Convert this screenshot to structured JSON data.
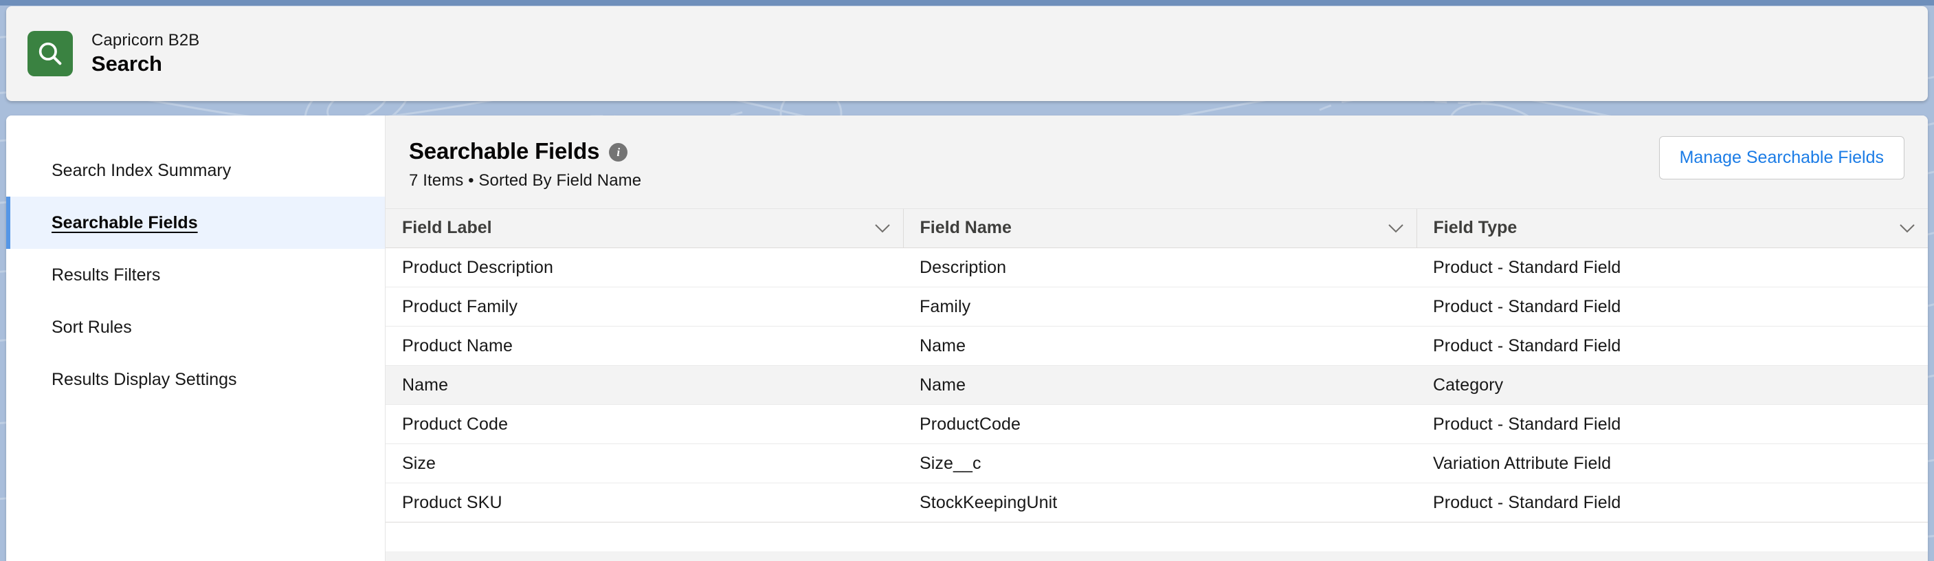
{
  "app": {
    "icon": "search-icon",
    "eyebrow": "Capricorn B2B",
    "title": "Search",
    "icon_color": "#3a8241"
  },
  "sidebar": {
    "items": [
      {
        "label": "Search Index Summary",
        "active": false
      },
      {
        "label": "Searchable Fields",
        "active": true
      },
      {
        "label": "Results Filters",
        "active": false
      },
      {
        "label": "Sort Rules",
        "active": false
      },
      {
        "label": "Results Display Settings",
        "active": false
      }
    ],
    "active_accent": "#5596e6",
    "active_background": "#ecf3fe"
  },
  "main": {
    "title": "Searchable Fields",
    "info_icon": "info-circle-icon",
    "subtitle": "7 Items • Sorted By Field Name",
    "item_count": 7,
    "sorted_by": "Field Name",
    "manage_button": "Manage Searchable Fields",
    "manage_button_color": "#1b7ce6"
  },
  "table": {
    "columns": [
      {
        "label": "Field Label",
        "sort_icon": "chevron-down-icon"
      },
      {
        "label": "Field Name",
        "sort_icon": "chevron-down-icon"
      },
      {
        "label": "Field Type",
        "sort_icon": "chevron-down-icon"
      }
    ],
    "rows": [
      {
        "field_label": "Product Description",
        "field_name": "Description",
        "field_type": "Product - Standard Field",
        "highlighted": false
      },
      {
        "field_label": "Product Family",
        "field_name": "Family",
        "field_type": "Product - Standard Field",
        "highlighted": false
      },
      {
        "field_label": "Product Name",
        "field_name": "Name",
        "field_type": "Product - Standard Field",
        "highlighted": false
      },
      {
        "field_label": "Name",
        "field_name": "Name",
        "field_type": "Category",
        "highlighted": true
      },
      {
        "field_label": "Product Code",
        "field_name": "ProductCode",
        "field_type": "Product - Standard Field",
        "highlighted": false
      },
      {
        "field_label": "Size",
        "field_name": "Size__c",
        "field_type": "Variation Attribute Field",
        "highlighted": false
      },
      {
        "field_label": "Product SKU",
        "field_name": "StockKeepingUnit",
        "field_type": "Product - Standard Field",
        "highlighted": false
      }
    ]
  }
}
